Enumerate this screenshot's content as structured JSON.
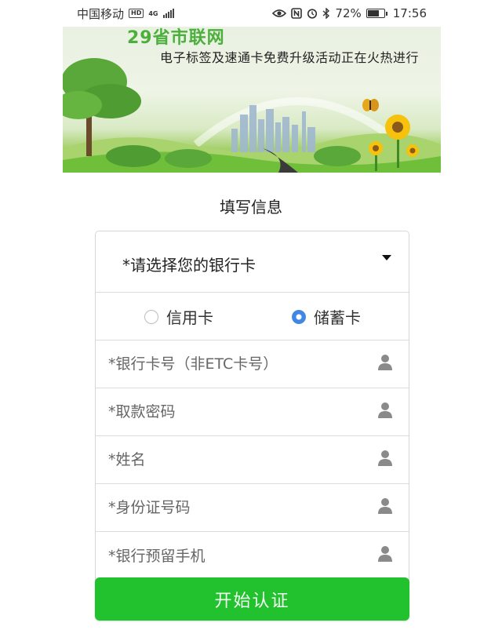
{
  "status_bar": {
    "carrier": "中国移动",
    "hd_badge": "HD",
    "network": "4G",
    "battery_percent": "72%",
    "battery_level": 0.72,
    "time": "17:56",
    "icons": [
      "eye-icon",
      "nfc-icon",
      "alarm-icon",
      "bluetooth-icon"
    ]
  },
  "banner": {
    "title": "29省市联网",
    "subtitle": "电子标签及速通卡免费升级活动正在火热进行"
  },
  "form": {
    "title": "填写信息",
    "bank_select_label": "*请选择您的银行卡",
    "card_types": [
      {
        "label": "信用卡",
        "selected": false
      },
      {
        "label": "储蓄卡",
        "selected": true
      }
    ],
    "fields": [
      {
        "placeholder": "*银行卡号（非ETC卡号）",
        "icon": "user-icon"
      },
      {
        "placeholder": "*取款密码",
        "icon": "user-icon"
      },
      {
        "placeholder": "*姓名",
        "icon": "user-icon"
      },
      {
        "placeholder": "*身份证号码",
        "icon": "user-icon"
      },
      {
        "placeholder": "*银行预留手机",
        "icon": "user-icon"
      }
    ],
    "submit_label": "开始认证"
  },
  "colors": {
    "submit_green": "#22c22e",
    "radio_blue": "#3f87e6",
    "banner_title_green": "#4caf3c"
  }
}
